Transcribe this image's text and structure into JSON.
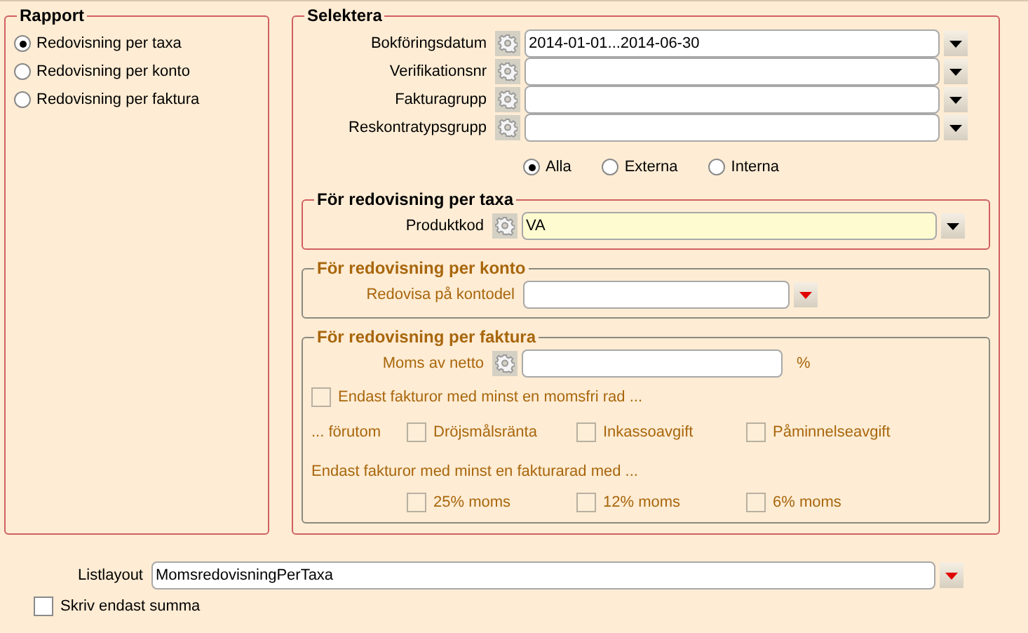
{
  "rapport": {
    "title": "Rapport",
    "options": [
      {
        "label": "Redovisning per taxa",
        "selected": true
      },
      {
        "label": "Redovisning per konto",
        "selected": false
      },
      {
        "label": "Redovisning per faktura",
        "selected": false
      }
    ]
  },
  "selektera": {
    "title": "Selektera",
    "fields": [
      {
        "kind": "lookup",
        "label": "Bokföringsdatum",
        "value": "2014-01-01...2014-06-30"
      },
      {
        "kind": "lookup",
        "label": "Verifikationsnr"
      },
      {
        "kind": "lookup",
        "label": "Fakturagrupp"
      },
      {
        "kind": "lookup",
        "label": "Reskontratypsgrupp"
      }
    ],
    "scope": [
      {
        "label": "Alla",
        "selected": true
      },
      {
        "label": "Externa",
        "selected": false
      },
      {
        "label": "Interna",
        "selected": false
      }
    ],
    "sections": [
      {
        "title": "För redovisning per taxa",
        "disabled": false,
        "rows": [
          {
            "kind": "lookup",
            "label": "Produktkod",
            "value": "VA",
            "highlighted": true
          }
        ]
      },
      {
        "title": "För redovisning per konto",
        "disabled": true,
        "rows": [
          {
            "kind": "list",
            "label": "Redovisa på kontodel"
          }
        ]
      },
      {
        "title": "För redovisning per faktura",
        "disabled": true,
        "rows": [
          {
            "kind": "percent",
            "label": "Moms av netto",
            "unit": "%"
          },
          {
            "kind": "checkbox",
            "label": "Endast fakturor med minst en momsfri rad ...",
            "checked": false
          },
          {
            "kind": "checkgroup",
            "label": "... förutom",
            "items": [
              {
                "label": "Dröjsmålsränta",
                "checked": false
              },
              {
                "label": "Inkassoavgift",
                "checked": false
              },
              {
                "label": "Påminnelseavgift",
                "checked": false
              }
            ]
          },
          {
            "kind": "note",
            "text": "Endast fakturor med minst en fakturarad med ..."
          },
          {
            "kind": "checkgroup",
            "items": [
              {
                "label": "25% moms",
                "checked": false
              },
              {
                "label": "12% moms",
                "checked": false
              },
              {
                "label": "6% moms",
                "checked": false
              }
            ]
          }
        ]
      }
    ]
  },
  "listlayout": {
    "kind": "list",
    "label": "Listlayout",
    "value": "MomsredovisningPerTaxa"
  },
  "summary_only": {
    "label": "Skriv endast summa",
    "checked": false
  }
}
